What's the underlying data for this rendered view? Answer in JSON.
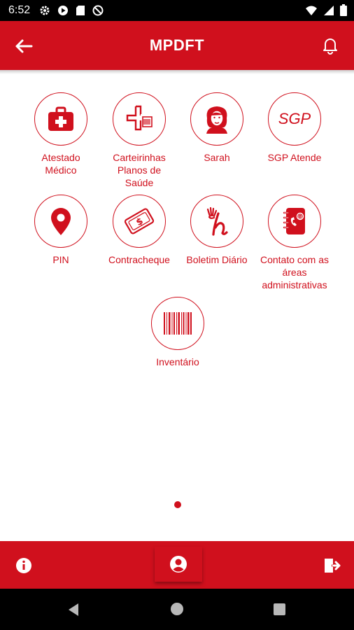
{
  "status_bar": {
    "time": "6:52",
    "icons": [
      "settings-icon",
      "play-protect-icon",
      "sd-card-icon",
      "do-not-disturb-icon",
      "wifi-icon",
      "signal-icon",
      "battery-icon"
    ]
  },
  "app_bar": {
    "title": "MPDFT",
    "back_icon": "arrow-left-icon",
    "notification_icon": "bell-icon"
  },
  "menu": {
    "items": [
      {
        "label": "Atestado\nMédico",
        "icon": "first-aid-kit-icon"
      },
      {
        "label": "Carteirinhas\nPlanos de\nSaúde",
        "icon": "health-card-icon"
      },
      {
        "label": "Sarah",
        "icon": "sarah-avatar-icon"
      },
      {
        "label": "SGP Atende",
        "icon": "sgp-logo-icon",
        "icon_text": "SGP"
      },
      {
        "label": "PIN",
        "icon": "map-pin-icon"
      },
      {
        "label": "Contracheque",
        "icon": "payslip-icon"
      },
      {
        "label": "Boletim Diário",
        "icon": "daily-bulletin-icon"
      },
      {
        "label": "Contato com as\náreas\nadministrativas",
        "icon": "contact-book-icon"
      },
      {
        "label": "Inventário",
        "icon": "barcode-icon"
      }
    ]
  },
  "pager": {
    "pages": 1,
    "current": 1
  },
  "bottom_bar": {
    "left_icon": "info-icon",
    "center_icon": "user-profile-icon",
    "right_icon": "logout-icon"
  },
  "colors": {
    "brand": "#d0101d",
    "background": "#ffffff"
  }
}
